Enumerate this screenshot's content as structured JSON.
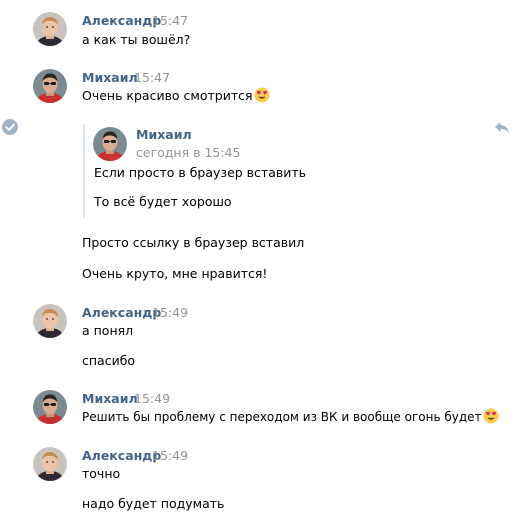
{
  "messages": [
    {
      "author": "Александр",
      "time": "15:47",
      "texts": [
        "а как ты вошёл?"
      ]
    },
    {
      "author": "Михаил",
      "time": "15:47",
      "texts": [
        "Очень красиво смотрится"
      ],
      "emoji": "heart-eyes-emoji",
      "forwarded": {
        "author": "Михаил",
        "time": "сегодня в 15:45",
        "texts": [
          "Если просто в браузер вставить",
          "То всё будет хорошо"
        ]
      },
      "after_texts": [
        "Просто ссылку в браузер вставил",
        "Очень круто, мне нравится!"
      ]
    },
    {
      "author": "Александр",
      "time": "15:49",
      "texts": [
        "а понял",
        "спасибо"
      ]
    },
    {
      "author": "Михаил",
      "time": "15:49",
      "texts": [
        "Решить бы проблему с переходом из ВК и вообще огонь будет"
      ],
      "emoji": "heart-eyes-emoji"
    },
    {
      "author": "Александр",
      "time": "15:49",
      "texts": [
        "точно",
        "надо будет подумать"
      ]
    }
  ],
  "icons": {
    "selected": "check-circle-icon",
    "reply": "reply-arrow-icon"
  },
  "colors": {
    "author": "#42648b",
    "time": "#939393",
    "text": "#000000",
    "quote_bar": "#dfe6ed",
    "icon": "#a2b3c6"
  }
}
